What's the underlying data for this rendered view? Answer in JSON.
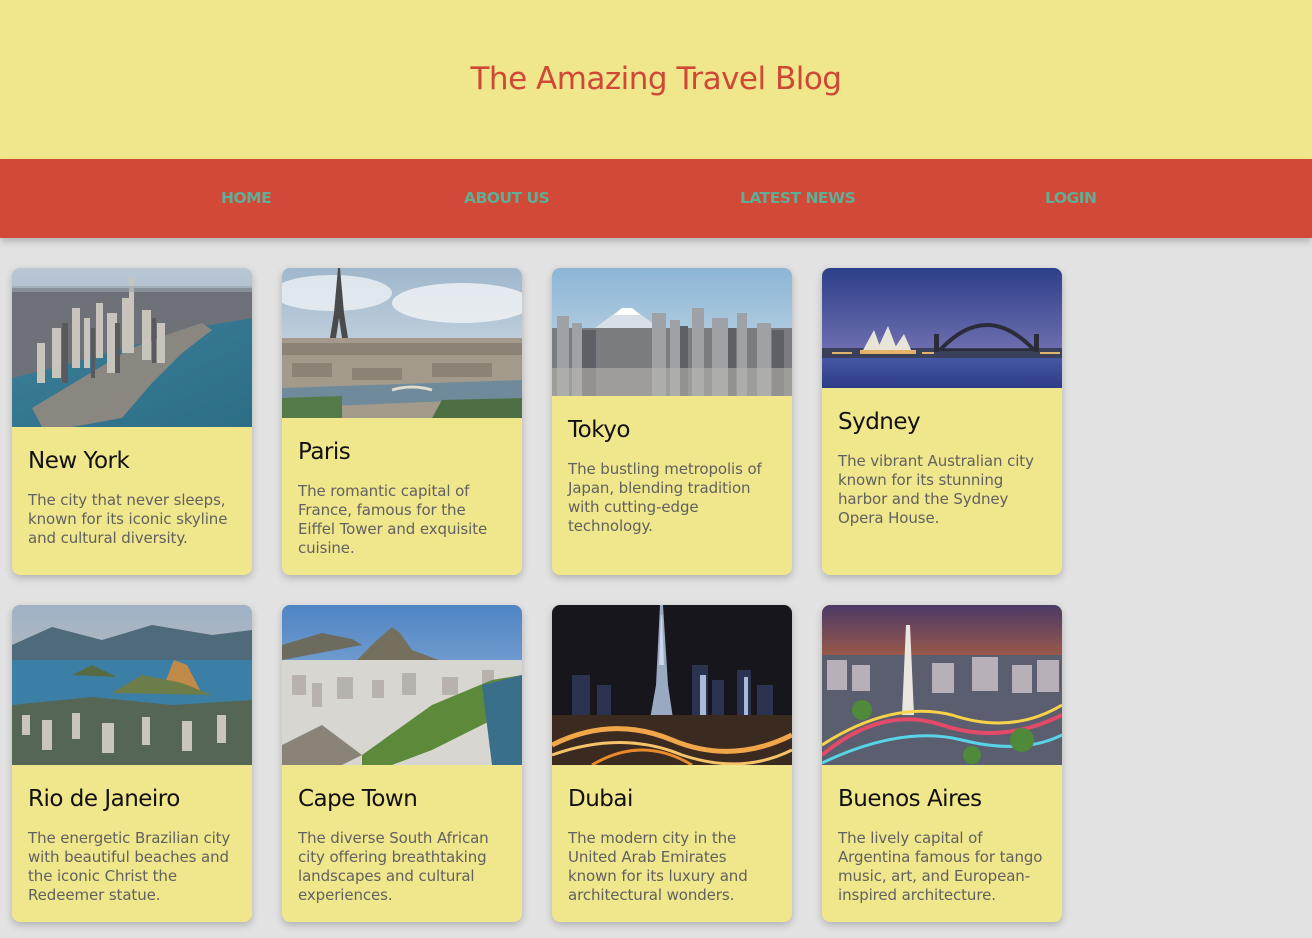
{
  "site": {
    "title": "The Amazing Travel Blog"
  },
  "nav": {
    "items": [
      {
        "label": "HOME"
      },
      {
        "label": "ABOUT US"
      },
      {
        "label": "LATEST NEWS"
      },
      {
        "label": "LOGIN"
      }
    ]
  },
  "cards": [
    {
      "title": "New York",
      "description": "The city that never sleeps, known for its iconic skyline and cultural diversity."
    },
    {
      "title": "Paris",
      "description": "The romantic capital of France, famous for the Eiffel Tower and exquisite cuisine."
    },
    {
      "title": "Tokyo",
      "description": "The bustling metropolis of Japan, blending tradition with cutting-edge technology."
    },
    {
      "title": "Sydney",
      "description": "The vibrant Australian city known for its stunning harbor and the Sydney Opera House."
    },
    {
      "title": "Rio de Janeiro",
      "description": "The energetic Brazilian city with beautiful beaches and the iconic Christ the Redeemer statue."
    },
    {
      "title": "Cape Town",
      "description": "The diverse South African city offering breathtaking landscapes and cultural experiences."
    },
    {
      "title": "Dubai",
      "description": "The modern city in the United Arab Emirates known for its luxury and architectural wonders."
    },
    {
      "title": "Buenos Aires",
      "description": "The lively capital of Argentina famous for tango music, art, and European-inspired architecture."
    }
  ],
  "colors": {
    "header_bg": "#f0e68c",
    "title": "#cf4836",
    "nav_bg": "#d24937",
    "nav_link": "#5fae96",
    "card_bg": "#f0e68c",
    "page_bg": "#e2e2e2"
  }
}
